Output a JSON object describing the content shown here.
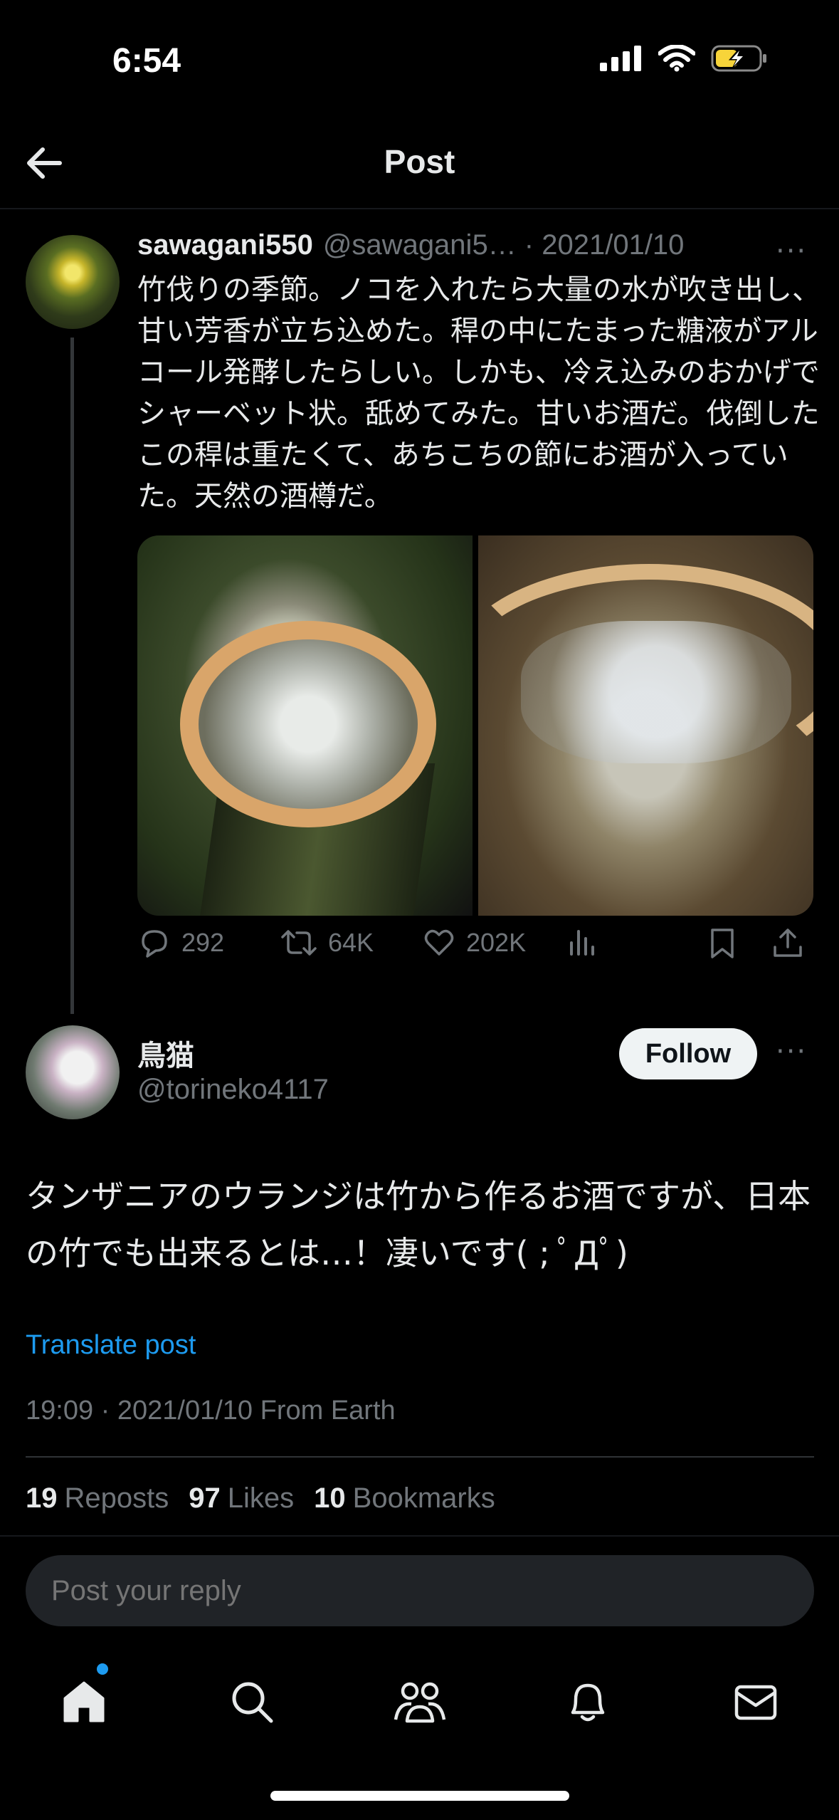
{
  "status": {
    "time": "6:54"
  },
  "header": {
    "title": "Post"
  },
  "original": {
    "username": "sawagani550",
    "handle": "@sawagani5… · 2021/01/10",
    "text": "竹伐りの季節。ノコを入れたら大量の水が吹き出し、甘い芳香が立ち込めた。稈の中にたまった糖液がアルコール発酵したらしい。しかも、冷え込みのおかげでシャーベット状。舐めてみた。甘いお酒だ。伐倒したこの稈は重たくて、あちこちの節にお酒が入っていた。天然の酒樽だ。",
    "more": "···",
    "actions": {
      "replies": "292",
      "reposts": "64K",
      "likes": "202K"
    }
  },
  "reply": {
    "name": "鳥猫",
    "handle": "@torineko4117",
    "follow_label": "Follow",
    "more": "···",
    "text": "タンザニアのウランジは竹から作るお酒ですが、日本の竹でも出来るとは…！凄いです( ; ﾟДﾟ)",
    "translate": "Translate post",
    "meta": "19:09 · 2021/01/10 From Earth",
    "stats": {
      "reposts_count": "19",
      "reposts_label": "Reposts",
      "likes_count": "97",
      "likes_label": "Likes",
      "bookmarks_count": "10",
      "bookmarks_label": "Bookmarks"
    }
  },
  "compose": {
    "placeholder": "Post your reply"
  },
  "nav": {
    "icons": [
      "home-icon",
      "search-icon",
      "communities-icon",
      "notifications-icon",
      "messages-icon"
    ]
  },
  "colors": {
    "accent": "#1d9bf0",
    "background": "#000000",
    "muted": "#71767b"
  }
}
